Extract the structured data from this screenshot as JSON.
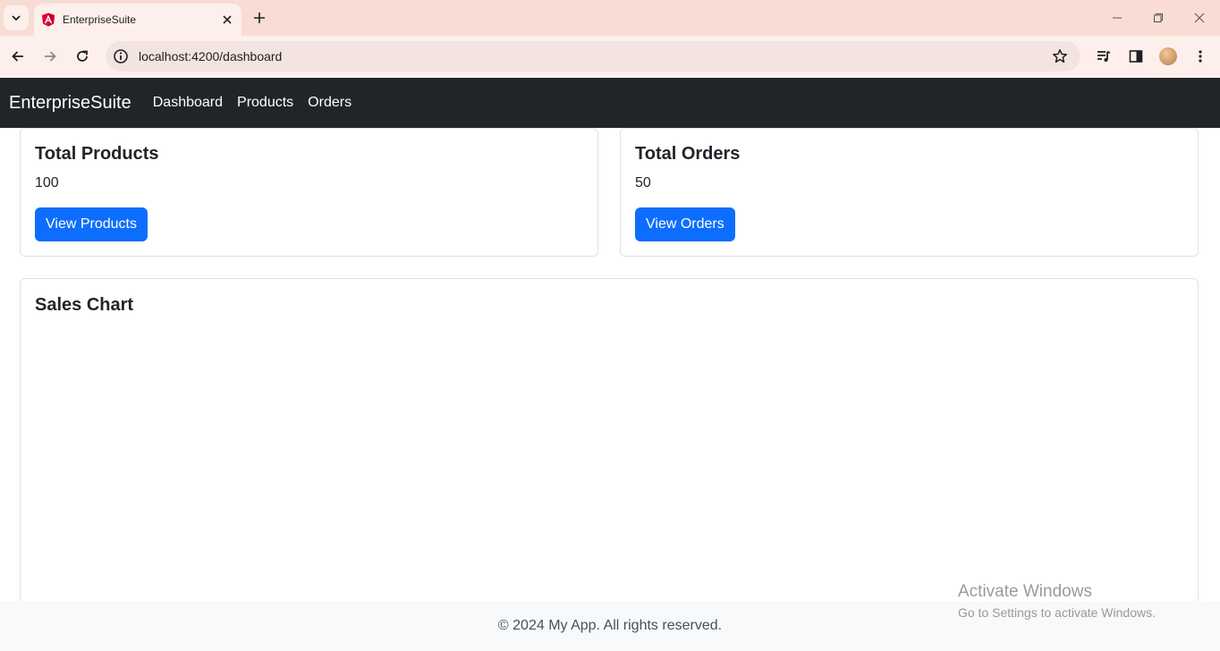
{
  "browser": {
    "tab_title": "EnterpriseSuite",
    "url": "localhost:4200/dashboard"
  },
  "navbar": {
    "brand": "EnterpriseSuite",
    "links": [
      "Dashboard",
      "Products",
      "Orders"
    ]
  },
  "cards": {
    "products": {
      "title": "Total Products",
      "value": "100",
      "button": "View Products"
    },
    "orders": {
      "title": "Total Orders",
      "value": "50",
      "button": "View Orders"
    },
    "sales": {
      "title": "Sales Chart"
    }
  },
  "footer": {
    "text": "© 2024 My App. All rights reserved."
  },
  "watermark": {
    "title": "Activate Windows",
    "subtitle": "Go to Settings to activate Windows."
  },
  "colors": {
    "primary": "#0d6efd",
    "navbar": "#212529",
    "tabstrip": "#f9dcd4"
  },
  "icons": [
    "tab-search-icon",
    "angular-favicon-icon",
    "close-icon",
    "plus-icon",
    "minimize-icon",
    "restore-icon",
    "window-close-icon",
    "back-icon",
    "forward-icon",
    "reload-icon",
    "site-info-icon",
    "star-icon",
    "media-icon",
    "side-panel-icon",
    "profile-avatar",
    "menu-icon"
  ]
}
